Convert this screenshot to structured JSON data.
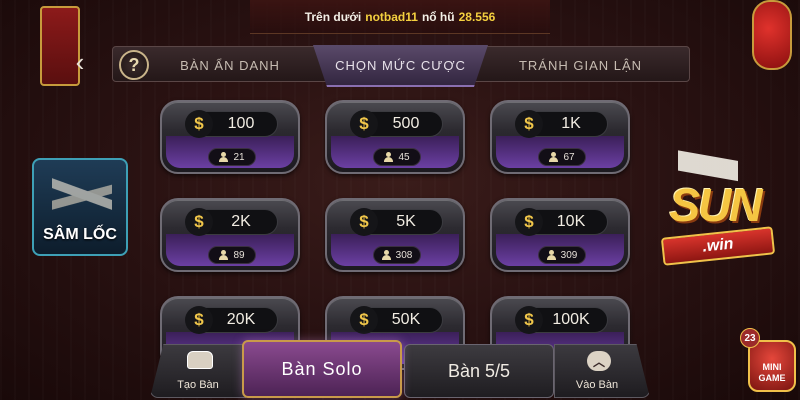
{
  "notice": {
    "prefix": "Trên dưới",
    "username": "notbad11",
    "middle": "nổ hũ",
    "amount": "28.556"
  },
  "tabs": [
    {
      "label": "BÀN ẨN DANH",
      "active": false
    },
    {
      "label": "CHỌN MỨC CƯỢC",
      "active": true
    },
    {
      "label": "TRÁNH GIAN LẬN",
      "active": false
    }
  ],
  "help_icon": "question-icon",
  "bets": [
    {
      "value": "100",
      "players": "21"
    },
    {
      "value": "500",
      "players": "45"
    },
    {
      "value": "1K",
      "players": "67"
    },
    {
      "value": "2K",
      "players": "89"
    },
    {
      "value": "5K",
      "players": "308"
    },
    {
      "value": "10K",
      "players": "309"
    },
    {
      "value": "20K",
      "players": ""
    },
    {
      "value": "50K",
      "players": ""
    },
    {
      "value": "100K",
      "players": ""
    }
  ],
  "currency_symbol": "$",
  "side": {
    "samloc_label": "SÂM LỐC",
    "logo_brand": "SUN",
    "logo_sub": ".win",
    "minigame_badge": "23",
    "minigame_label": "MINI GAME"
  },
  "bottom": {
    "create_label": "Tạo Bàn",
    "solo_label": "Bàn Solo",
    "five_label": "Bàn 5/5",
    "join_label": "Vào Bàn"
  },
  "colors": {
    "accent_gold": "#f4d03f",
    "tier_purple": "#6b3fa3",
    "samloc_border": "#3ea0b6"
  }
}
